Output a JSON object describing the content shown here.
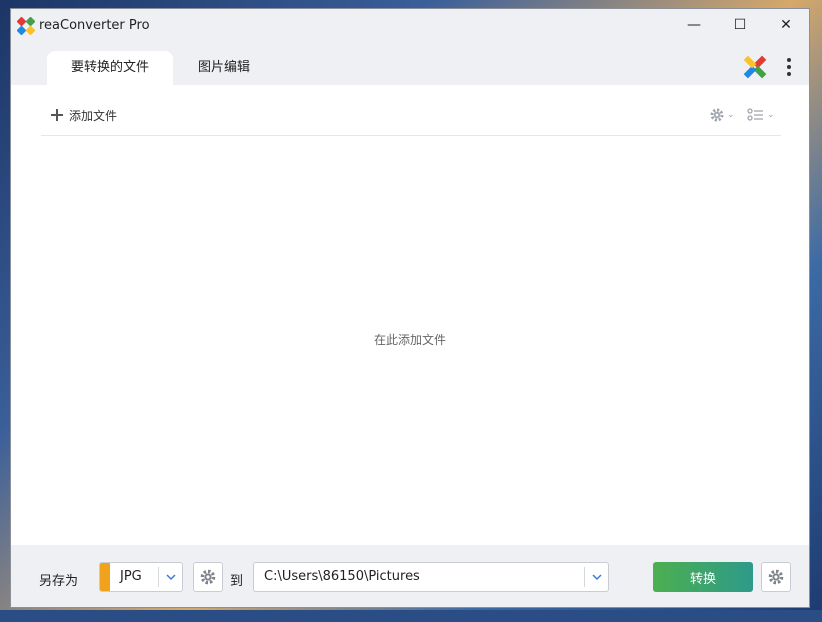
{
  "window": {
    "title": "reaConverter Pro",
    "controls": {
      "minimize": "—",
      "maximize": "☐",
      "close": "✕"
    }
  },
  "tabs": [
    {
      "label": "要转换的文件",
      "active": true
    },
    {
      "label": "图片编辑",
      "active": false
    }
  ],
  "toolbar": {
    "add_file_label": "添加文件",
    "settings_icon": "gear-icon",
    "view_icon": "list-view-icon"
  },
  "main": {
    "empty_hint": "在此添加文件"
  },
  "bottom": {
    "save_as_label": "另存为",
    "format_value": "JPG",
    "to_label": "到",
    "path_value": "C:\\Users\\86150\\Pictures",
    "convert_label": "转换"
  },
  "colors": {
    "format_accent": "#f0a21c",
    "convert_start": "#4caf50",
    "convert_end": "#2e9a8a"
  }
}
